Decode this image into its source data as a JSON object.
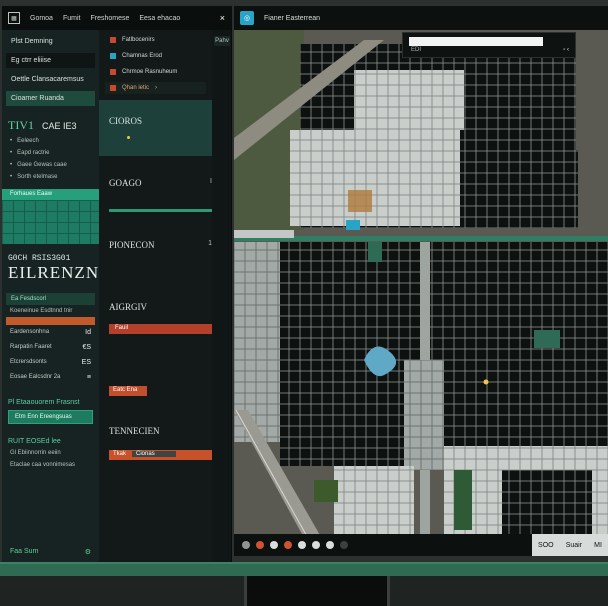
{
  "left_app": {
    "title_items": [
      "Gomoa",
      "Fumit",
      "Freshomese",
      "Eesa ehacao"
    ],
    "close": "×",
    "colA": {
      "buttons": [
        "Plst Demning",
        "Eg ctrr eliiise",
        "Oettle Clansacaremsus",
        "Cioamer Ruanda"
      ],
      "head_big": "TIV1",
      "head_mid": "CAE IE3",
      "rows": [
        "Eeleech",
        "Eapd ractrie",
        "Gaee Gewas caae",
        "Sorth etelmase"
      ],
      "calendar_title": "Forhaues Eaaw",
      "title1": "G0CH RSIS3G01",
      "title2": "EILRENZNOG",
      "tag": "Ea Fesdscorl",
      "tag2": "Koeneinue Esdtnnd tnir",
      "stats": [
        {
          "label": "Eardensonhna",
          "value": "Id"
        },
        {
          "label": "Rarpatin Faaret",
          "value": "€S"
        },
        {
          "label": "Etcrersdsonts",
          "value": "ES"
        },
        {
          "label": "Eosae Ealcsdnr 2a",
          "value": "≡"
        }
      ],
      "section": "Pl Etaaouorem Frasnst",
      "green_btn": "Etm Enn Ereengsuas",
      "section2": "RUIT EOSEd lee",
      "notes": [
        "Gl Ebiinnorrin eeiin",
        "Etaclae caa vonnimesas"
      ],
      "footer_left": "Faa Sum",
      "footer_right": "⚙"
    },
    "colB": {
      "menu": [
        "Fatlbocenirs",
        "Chamnas Erod",
        "Chrmoe Rasnuheum",
        "Qhan ietic"
      ],
      "cards": [
        {
          "label": "CIOROS"
        },
        {
          "label": "GOAGO",
          "value": "I"
        },
        {
          "label": "PIONECON",
          "value": "1"
        },
        {
          "label": "AIGRGIV",
          "bar": "Fauil"
        },
        {
          "label": "",
          "bar": "Eatc Ena"
        },
        {
          "label": "TENNECIEN",
          "bar": "Tkak",
          "bar2": "Cionas"
        }
      ]
    },
    "colC": {
      "tab": "Pahv"
    }
  },
  "right_app": {
    "title": "Fianer Easterrean",
    "search": {
      "label": "EDI",
      "controls": "▫ ‹"
    },
    "status": [
      "SOO",
      "Suair",
      "MI"
    ]
  },
  "colors": {
    "accent": "#2e9873",
    "alert": "#c14e2c",
    "bg": "#121918"
  }
}
